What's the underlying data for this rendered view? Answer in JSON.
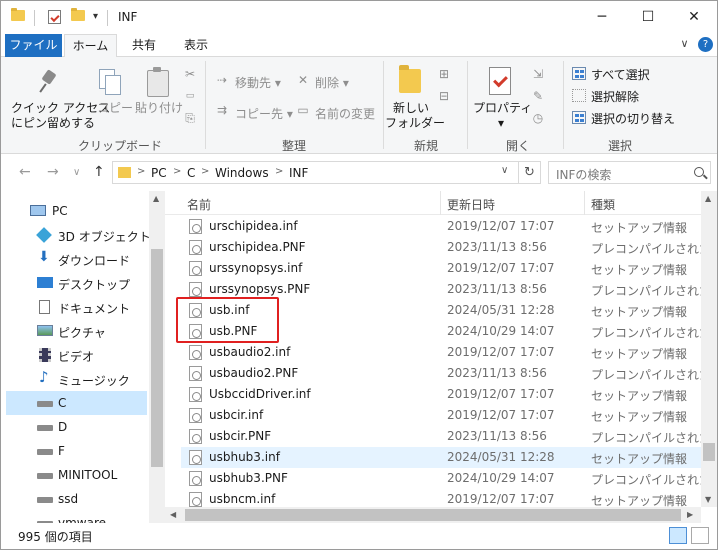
{
  "window": {
    "title": "INF",
    "minimize": "─",
    "maximize": "☐",
    "close": "✕"
  },
  "tabs": {
    "file": "ファイル",
    "home": "ホーム",
    "share": "共有",
    "view": "表示",
    "expand": "∨",
    "help": "?"
  },
  "ribbon": {
    "clipboard": {
      "pin_label": "クイック アクセス\nにピン留めする",
      "pin_line1": "クイック アクセス",
      "pin_line2": "にピン留めする",
      "copy": "コピー",
      "paste": "貼り付け",
      "group": "クリップボード"
    },
    "organize": {
      "move_to": "移動先",
      "copy_to": "コピー先",
      "delete": "削除",
      "rename": "名前の変更",
      "group": "整理"
    },
    "new": {
      "new_folder_line1": "新しい",
      "new_folder_line2": "フォルダー",
      "group": "新規"
    },
    "open": {
      "properties": "プロパティ",
      "group": "開く"
    },
    "select": {
      "select_all": "すべて選択",
      "select_none": "選択解除",
      "invert": "選択の切り替え",
      "group": "選択"
    }
  },
  "address": {
    "back": "←",
    "forward": "→",
    "recent": "∨",
    "up": "↑",
    "crumbs": [
      "PC",
      "C",
      "Windows",
      "INF"
    ],
    "refresh": "↻",
    "search_placeholder": "INFの検索"
  },
  "nav": {
    "items": [
      {
        "label": "PC",
        "icon": "pc-icon"
      },
      {
        "label": "3D オブジェクト",
        "icon": "3d-objects-icon"
      },
      {
        "label": "ダウンロード",
        "icon": "download-icon"
      },
      {
        "label": "デスクトップ",
        "icon": "desktop-icon"
      },
      {
        "label": "ドキュメント",
        "icon": "document-icon"
      },
      {
        "label": "ピクチャ",
        "icon": "pictures-icon"
      },
      {
        "label": "ビデオ",
        "icon": "video-icon"
      },
      {
        "label": "ミュージック",
        "icon": "music-icon"
      },
      {
        "label": "C",
        "icon": "drive-icon"
      },
      {
        "label": "D",
        "icon": "drive-icon"
      },
      {
        "label": "F",
        "icon": "drive-icon"
      },
      {
        "label": "MINITOOL",
        "icon": "drive-icon"
      },
      {
        "label": "ssd",
        "icon": "drive-icon"
      },
      {
        "label": "vmware",
        "icon": "drive-icon"
      }
    ]
  },
  "files": {
    "columns": {
      "name": "名前",
      "date": "更新日時",
      "type": "種類",
      "sort": "^"
    },
    "rows": [
      {
        "name": "urschipidea.inf",
        "date": "2019/12/07 17:07",
        "type": "セットアップ情報"
      },
      {
        "name": "urschipidea.PNF",
        "date": "2023/11/13 8:56",
        "type": "プレコンパイルされた..."
      },
      {
        "name": "urssynopsys.inf",
        "date": "2019/12/07 17:07",
        "type": "セットアップ情報"
      },
      {
        "name": "urssynopsys.PNF",
        "date": "2023/11/13 8:56",
        "type": "プレコンパイルされた..."
      },
      {
        "name": "usb.inf",
        "date": "2024/05/31 12:28",
        "type": "セットアップ情報"
      },
      {
        "name": "usb.PNF",
        "date": "2024/10/29 14:07",
        "type": "プレコンパイルされた..."
      },
      {
        "name": "usbaudio2.inf",
        "date": "2019/12/07 17:07",
        "type": "セットアップ情報"
      },
      {
        "name": "usbaudio2.PNF",
        "date": "2023/11/13 8:56",
        "type": "プレコンパイルされた..."
      },
      {
        "name": "UsbccidDriver.inf",
        "date": "2019/12/07 17:07",
        "type": "セットアップ情報"
      },
      {
        "name": "usbcir.inf",
        "date": "2019/12/07 17:07",
        "type": "セットアップ情報"
      },
      {
        "name": "usbcir.PNF",
        "date": "2023/11/13 8:56",
        "type": "プレコンパイルされた..."
      },
      {
        "name": "usbhub3.inf",
        "date": "2024/05/31 12:28",
        "type": "セットアップ情報"
      },
      {
        "name": "usbhub3.PNF",
        "date": "2024/10/29 14:07",
        "type": "プレコンパイルされた..."
      },
      {
        "name": "usbncm.inf",
        "date": "2019/12/07 17:07",
        "type": "セットアップ情報"
      }
    ]
  },
  "status": {
    "count": "995 個の項目"
  },
  "colors": {
    "accent": "#1e6fc2",
    "selection": "#cce8ff",
    "hover_row": "#e5f3ff",
    "highlight_box": "#e02020",
    "folder": "#f3c94f"
  }
}
